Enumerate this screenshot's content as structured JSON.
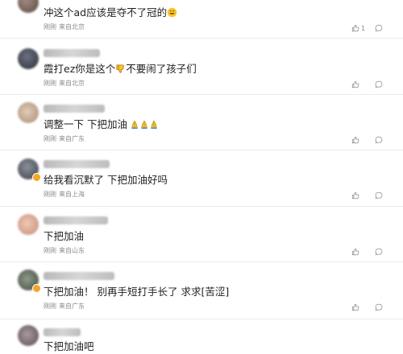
{
  "colors": {
    "text": "#1f1f1f",
    "meta": "#8a8a8a",
    "divider": "#ececec",
    "vip_badge": "#f5a623"
  },
  "comments": [
    {
      "username": "",
      "text": "冲这个ad应该是夺不了冠的",
      "emoji": [
        "grinning-face-icon"
      ],
      "time": "刚刚",
      "location": "来自北京",
      "likes": "1"
    },
    {
      "username": "",
      "text_before": "霞打ez你是这个",
      "text_after": "不要闹了孩子们",
      "emoji": [
        "thumbs-down-icon"
      ],
      "time": "刚刚",
      "location": "来自北京",
      "likes": ""
    },
    {
      "username": "",
      "text": "调整一下 下把加油",
      "emoji": [
        "pray-icon",
        "pray-icon",
        "pray-icon"
      ],
      "time": "刚刚",
      "location": "来自广东",
      "likes": ""
    },
    {
      "username": "",
      "text": "给我看沉默了 下把加油好吗",
      "emoji": [],
      "time": "刚刚",
      "location": "来自上海",
      "likes": ""
    },
    {
      "username": "",
      "text": "下把加油",
      "emoji": [],
      "time": "刚刚",
      "location": "来自山东",
      "likes": ""
    },
    {
      "username": "",
      "text": "下把加油！ 别再手短打手长了 求求[苦涩]",
      "emoji": [],
      "time": "刚刚",
      "location": "来自广东",
      "likes": ""
    },
    {
      "username": "",
      "text": "下把加油吧",
      "emoji": [],
      "time": "",
      "location": "",
      "likes": ""
    }
  ]
}
